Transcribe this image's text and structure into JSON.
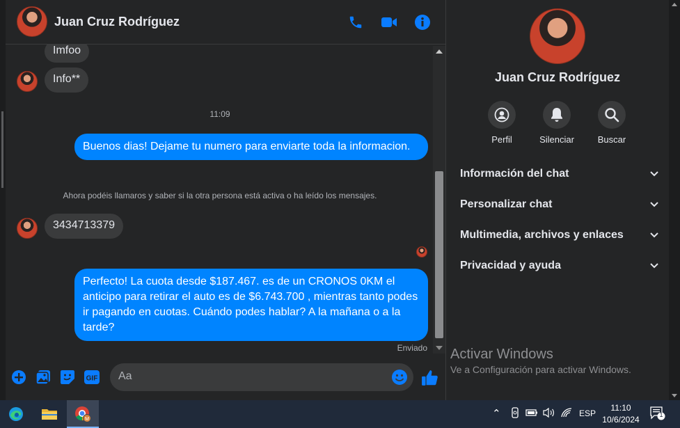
{
  "contact": {
    "name": "Juan Cruz Rodríguez"
  },
  "header_icons": {
    "call": "phone-icon",
    "video": "video-camera-icon",
    "info": "info-icon"
  },
  "messages": {
    "m1": "Imfoo",
    "m2": "Info**",
    "time_sep": "11:09",
    "m3": "Buenos dias! Dejame tu numero para enviarte toda la informacion.",
    "notice": "Ahora podéis llamaros y saber si la otra persona está activa o ha leído los mensajes.",
    "m4": "3434713379",
    "m5": "Perfecto! La cuota desde $187.467. es de un CRONOS 0KM el anticipo para retirar el auto es de $6.743.700 , mientras tanto podes ir pagando en cuotas. Cuándo podes hablar? A la mañana o a la tarde?",
    "status": "Enviado"
  },
  "composer": {
    "placeholder": "Aa",
    "icons": [
      "plus-icon",
      "image-icon",
      "sticker-icon",
      "gif-icon",
      "emoji-icon",
      "thumbs-up-icon"
    ],
    "gif_label": "GIF"
  },
  "panel": {
    "name": "Juan Cruz Rodríguez",
    "actions": [
      {
        "label": "Perfil",
        "icon": "profile-icon"
      },
      {
        "label": "Silenciar",
        "icon": "bell-icon"
      },
      {
        "label": "Buscar",
        "icon": "search-icon"
      }
    ],
    "sections": [
      "Información del chat",
      "Personalizar chat",
      "Multimedia, archivos y enlaces",
      "Privacidad y ayuda"
    ]
  },
  "watermark": {
    "title": "Activar Windows",
    "subtitle": "Ve a Configuración para activar Windows."
  },
  "taskbar": {
    "apps": [
      "edge-icon",
      "file-explorer-icon",
      "chrome-icon"
    ],
    "lang": "ESP",
    "time": "11:10",
    "date": "10/6/2024",
    "notification_count": "1"
  },
  "colors": {
    "accent": "#0084ff",
    "background": "#242526",
    "bubble_in": "#3a3b3c"
  }
}
